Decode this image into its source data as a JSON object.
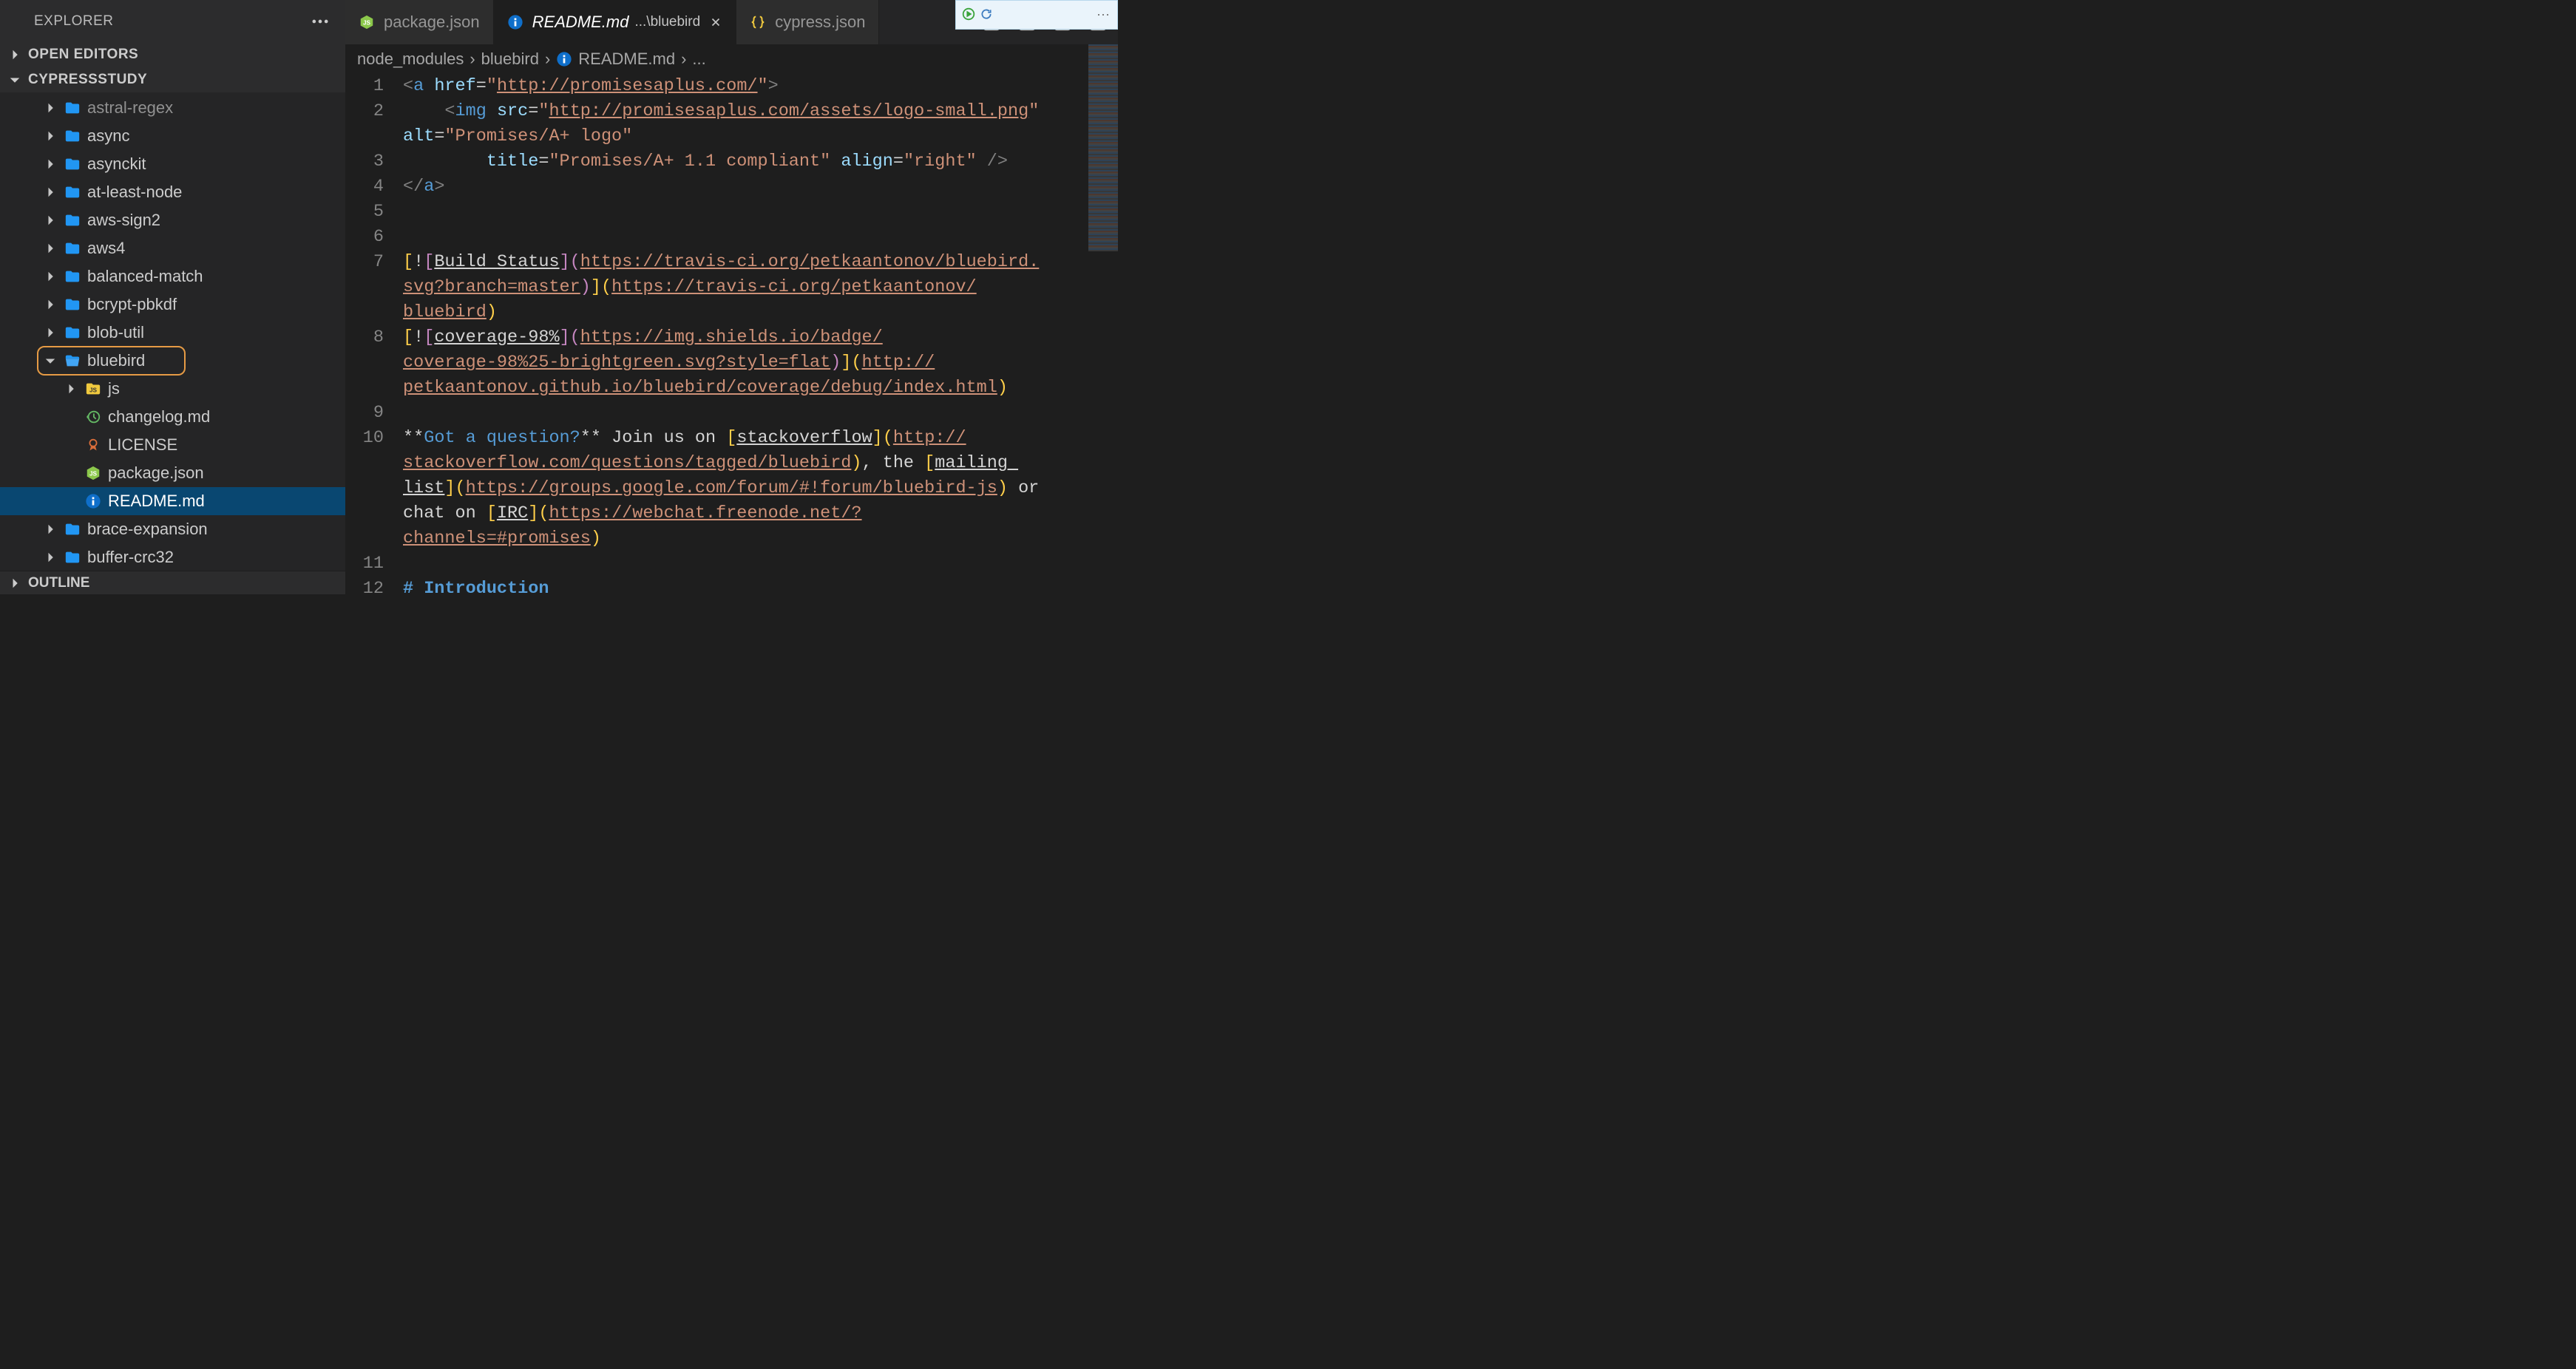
{
  "explorer": {
    "title": "EXPLORER",
    "sections": {
      "open_editors": "OPEN EDITORS",
      "workspace": "CYPRESSSTUDY",
      "outline": "OUTLINE"
    }
  },
  "tree": [
    {
      "icon": "folder",
      "label": "astral-regex",
      "depth": 0,
      "dim": true
    },
    {
      "icon": "folder",
      "label": "async",
      "depth": 0
    },
    {
      "icon": "folder",
      "label": "asynckit",
      "depth": 0
    },
    {
      "icon": "folder",
      "label": "at-least-node",
      "depth": 0
    },
    {
      "icon": "folder",
      "label": "aws-sign2",
      "depth": 0
    },
    {
      "icon": "folder",
      "label": "aws4",
      "depth": 0
    },
    {
      "icon": "folder",
      "label": "balanced-match",
      "depth": 0
    },
    {
      "icon": "folder",
      "label": "bcrypt-pbkdf",
      "depth": 0
    },
    {
      "icon": "folder",
      "label": "blob-util",
      "depth": 0
    },
    {
      "icon": "folder-open",
      "label": "bluebird",
      "depth": 0,
      "expanded": true,
      "highlighted": true
    },
    {
      "icon": "js-folder",
      "label": "js",
      "depth": 1,
      "hasTwistie": true
    },
    {
      "icon": "history",
      "label": "changelog.md",
      "depth": 1
    },
    {
      "icon": "cert",
      "label": "LICENSE",
      "depth": 1
    },
    {
      "icon": "nodejs",
      "label": "package.json",
      "depth": 1
    },
    {
      "icon": "info",
      "label": "README.md",
      "depth": 1,
      "selected": true
    },
    {
      "icon": "folder",
      "label": "brace-expansion",
      "depth": 0
    },
    {
      "icon": "folder",
      "label": "buffer-crc32",
      "depth": 0
    }
  ],
  "tabs": [
    {
      "icon": "nodejs",
      "label": "package.json",
      "active": false
    },
    {
      "icon": "info",
      "label": "README.md",
      "subpath": "...\\bluebird",
      "active": true,
      "closable": true
    },
    {
      "icon": "json",
      "label": "cypress.json",
      "active": false
    }
  ],
  "breadcrumbs": {
    "parts": [
      "node_modules",
      "bluebird"
    ],
    "file_icon": "info",
    "file": "README.md",
    "trail": "..."
  },
  "code": {
    "lines": [
      {
        "n": 1,
        "segs": [
          [
            "<",
            "t-tag-angle"
          ],
          [
            "a",
            "t-tag-name"
          ],
          [
            " ",
            "t-text"
          ],
          [
            "href",
            "t-attr"
          ],
          [
            "=",
            "t-op"
          ],
          [
            "\"",
            "t-str"
          ],
          [
            "http://promisesaplus.com/",
            "t-str-link"
          ],
          [
            "\"",
            "t-str"
          ],
          [
            ">",
            "t-tag-angle"
          ]
        ]
      },
      {
        "n": 2,
        "segs": [
          [
            "    ",
            "t-text"
          ],
          [
            "<",
            "t-tag-angle"
          ],
          [
            "img",
            "t-tag-name"
          ],
          [
            " ",
            "t-text"
          ],
          [
            "src",
            "t-attr"
          ],
          [
            "=",
            "t-op"
          ],
          [
            "\"",
            "t-str"
          ],
          [
            "http://promisesaplus.com/assets/logo-small.png",
            "t-str-link"
          ],
          [
            "\"",
            "t-str"
          ]
        ],
        "wrap": [
          [
            "alt",
            "t-attr"
          ],
          [
            "=",
            "t-op"
          ],
          [
            "\"Promises/A+ logo\"",
            "t-str"
          ]
        ]
      },
      {
        "n": 3,
        "segs": [
          [
            "        ",
            "t-text"
          ],
          [
            "title",
            "t-attr"
          ],
          [
            "=",
            "t-op"
          ],
          [
            "\"Promises/A+ 1.1 compliant\"",
            "t-str"
          ],
          [
            " ",
            "t-text"
          ],
          [
            "align",
            "t-attr"
          ],
          [
            "=",
            "t-op"
          ],
          [
            "\"right\"",
            "t-str"
          ],
          [
            " ",
            "t-text"
          ],
          [
            "/>",
            "t-tag-angle"
          ]
        ]
      },
      {
        "n": 4,
        "segs": [
          [
            "</",
            "t-tag-angle"
          ],
          [
            "a",
            "t-tag-name"
          ],
          [
            ">",
            "t-tag-angle"
          ]
        ]
      },
      {
        "n": 5,
        "segs": [
          [
            "",
            "t-text"
          ]
        ]
      },
      {
        "n": 6,
        "segs": [
          [
            "",
            "t-text"
          ]
        ]
      },
      {
        "n": 7,
        "compound": "build_status"
      },
      {
        "n": 8,
        "compound": "coverage"
      },
      {
        "n": 9,
        "segs": [
          [
            "",
            "t-text"
          ]
        ]
      },
      {
        "n": 10,
        "compound": "question"
      },
      {
        "n": 11,
        "segs": [
          [
            "",
            "t-text"
          ]
        ]
      },
      {
        "n": 12,
        "segs": [
          [
            "# Introduction",
            "t-header"
          ]
        ]
      }
    ],
    "compound": {
      "build_status": {
        "rows": [
          [
            [
              "[",
              "t-paren-y"
            ],
            [
              "!",
              "t-text"
            ],
            [
              "[",
              "t-paren-v"
            ],
            [
              "Build Status",
              "t-linklabel"
            ],
            [
              "]",
              "t-paren-v"
            ],
            [
              "(",
              "t-paren-v"
            ],
            [
              "https://travis-ci.org/petkaantonov/bluebird.",
              "t-str-link"
            ]
          ],
          [
            [
              "svg?branch=master",
              "t-str-link"
            ],
            [
              ")",
              "t-paren-v"
            ],
            [
              "]",
              "t-paren-y"
            ],
            [
              "(",
              "t-paren-y"
            ],
            [
              "https://travis-ci.org/petkaantonov/",
              "t-str-link"
            ]
          ],
          [
            [
              "bluebird",
              "t-str-link"
            ],
            [
              ")",
              "t-paren-y"
            ]
          ]
        ]
      },
      "coverage": {
        "rows": [
          [
            [
              "[",
              "t-paren-y"
            ],
            [
              "!",
              "t-text"
            ],
            [
              "[",
              "t-paren-v"
            ],
            [
              "coverage-98%",
              "t-linklabel"
            ],
            [
              "]",
              "t-paren-v"
            ],
            [
              "(",
              "t-paren-v"
            ],
            [
              "https://img.shields.io/badge/",
              "t-str-link"
            ]
          ],
          [
            [
              "coverage-98%25-brightgreen.svg?style=flat",
              "t-str-link"
            ],
            [
              ")",
              "t-paren-v"
            ],
            [
              "]",
              "t-paren-y"
            ],
            [
              "(",
              "t-paren-y"
            ],
            [
              "http://",
              "t-str-link"
            ]
          ],
          [
            [
              "petkaantonov.github.io/bluebird/coverage/debug/index.html",
              "t-str-link"
            ],
            [
              ")",
              "t-paren-y"
            ]
          ]
        ]
      },
      "question": {
        "rows": [
          [
            [
              "**",
              "t-text"
            ],
            [
              "Got a question?",
              "t-bold"
            ],
            [
              "**",
              "t-text"
            ],
            [
              " Join us on ",
              "t-text"
            ],
            [
              "[",
              "t-paren-y"
            ],
            [
              "stackoverflow",
              "t-linklabel"
            ],
            [
              "]",
              "t-paren-y"
            ],
            [
              "(",
              "t-paren-y"
            ],
            [
              "http://",
              "t-str-link"
            ]
          ],
          [
            [
              "stackoverflow.com/questions/tagged/bluebird",
              "t-str-link"
            ],
            [
              ")",
              "t-paren-y"
            ],
            [
              ", the ",
              "t-text"
            ],
            [
              "[",
              "t-paren-y"
            ],
            [
              "mailing ",
              "t-linklabel"
            ]
          ],
          [
            [
              "list",
              "t-linklabel"
            ],
            [
              "]",
              "t-paren-y"
            ],
            [
              "(",
              "t-paren-y"
            ],
            [
              "https://groups.google.com/forum/#!forum/bluebird-js",
              "t-str-link"
            ],
            [
              ")",
              "t-paren-y"
            ],
            [
              " or ",
              "t-text"
            ]
          ],
          [
            [
              "chat on ",
              "t-text"
            ],
            [
              "[",
              "t-paren-y"
            ],
            [
              "IRC",
              "t-linklabel"
            ],
            [
              "]",
              "t-paren-y"
            ],
            [
              "(",
              "t-paren-y"
            ],
            [
              "https://webchat.freenode.net/?",
              "t-str-link"
            ]
          ],
          [
            [
              "channels=#promises",
              "t-str-link"
            ],
            [
              ")",
              "t-paren-y"
            ]
          ]
        ]
      }
    }
  }
}
